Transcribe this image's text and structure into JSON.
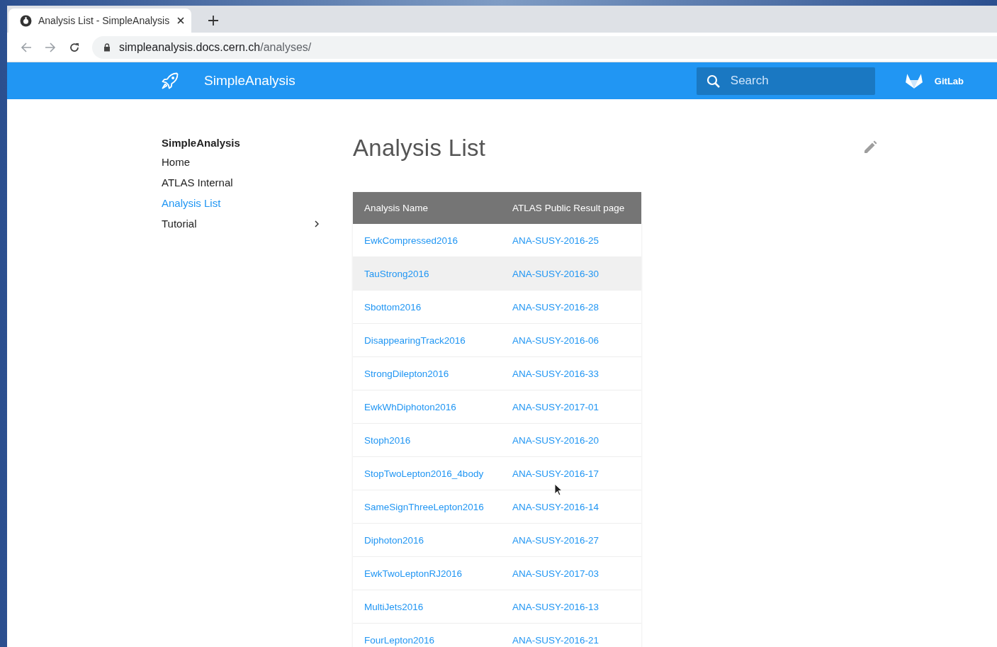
{
  "browser": {
    "tab_title": "Analysis List - SimpleAnalysis",
    "url_host": "simpleanalysis.docs.cern.ch",
    "url_path": "/analyses/"
  },
  "header": {
    "site_name": "SimpleAnalysis",
    "search_placeholder": "Search",
    "repo_label": "GitLab"
  },
  "sidebar": {
    "title": "SimpleAnalysis",
    "items": [
      {
        "label": "Home",
        "selected": false,
        "has_children": false
      },
      {
        "label": "ATLAS Internal",
        "selected": false,
        "has_children": false
      },
      {
        "label": "Analysis List",
        "selected": true,
        "has_children": false
      },
      {
        "label": "Tutorial",
        "selected": false,
        "has_children": true
      }
    ]
  },
  "page": {
    "title": "Analysis List"
  },
  "table": {
    "columns": [
      "Analysis Name",
      "ATLAS Public Result page"
    ],
    "rows": [
      {
        "name": "EwkCompressed2016",
        "page": "ANA-SUSY-2016-25",
        "highlighted": false
      },
      {
        "name": "TauStrong2016",
        "page": "ANA-SUSY-2016-30",
        "highlighted": true
      },
      {
        "name": "Sbottom2016",
        "page": "ANA-SUSY-2016-28",
        "highlighted": false
      },
      {
        "name": "DisappearingTrack2016",
        "page": "ANA-SUSY-2016-06",
        "highlighted": false
      },
      {
        "name": "StrongDilepton2016",
        "page": "ANA-SUSY-2016-33",
        "highlighted": false
      },
      {
        "name": "EwkWhDiphoton2016",
        "page": "ANA-SUSY-2017-01",
        "highlighted": false
      },
      {
        "name": "Stoph2016",
        "page": "ANA-SUSY-2016-20",
        "highlighted": false
      },
      {
        "name": "StopTwoLepton2016_4body",
        "page": "ANA-SUSY-2016-17",
        "highlighted": false
      },
      {
        "name": "SameSignThreeLepton2016",
        "page": "ANA-SUSY-2016-14",
        "highlighted": false
      },
      {
        "name": "Diphoton2016",
        "page": "ANA-SUSY-2016-27",
        "highlighted": false
      },
      {
        "name": "EwkTwoLeptonRJ2016",
        "page": "ANA-SUSY-2017-03",
        "highlighted": false
      },
      {
        "name": "MultiJets2016",
        "page": "ANA-SUSY-2016-13",
        "highlighted": false
      },
      {
        "name": "FourLepton2016",
        "page": "ANA-SUSY-2016-21",
        "highlighted": false
      }
    ]
  }
}
